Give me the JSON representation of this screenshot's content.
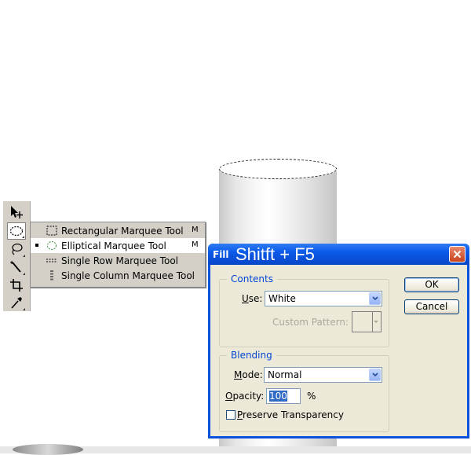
{
  "toolbox": {
    "tools": [
      {
        "name": "move-tool",
        "icon": "move-arrow-icon",
        "selected": false
      },
      {
        "name": "elliptical-marquee-tool",
        "icon": "ellipse-marquee-icon",
        "selected": true
      },
      {
        "name": "lasso-tool",
        "icon": "lasso-icon",
        "selected": false
      },
      {
        "name": "magic-wand-tool",
        "icon": "magic-wand-icon",
        "selected": false
      },
      {
        "name": "crop-tool",
        "icon": "crop-icon",
        "selected": false
      },
      {
        "name": "eyedropper-tool",
        "icon": "eyedropper-icon",
        "selected": false
      }
    ]
  },
  "flyout": {
    "items": [
      {
        "label": "Rectangular Marquee Tool",
        "shortcut": "M",
        "icon": "rect-marquee-icon",
        "active": false
      },
      {
        "label": "Elliptical Marquee Tool",
        "shortcut": "M",
        "icon": "ellipse-marquee-icon",
        "active": true
      },
      {
        "label": "Single Row Marquee Tool",
        "shortcut": "",
        "icon": "single-row-marquee-icon",
        "active": false
      },
      {
        "label": "Single Column Marquee Tool",
        "shortcut": "",
        "icon": "single-column-marquee-icon",
        "active": false
      }
    ]
  },
  "dialog": {
    "title": "Fill",
    "title_annotation": "Shitft + F5",
    "contents": {
      "legend": "Contents",
      "use_label_u": "U",
      "use_label_rest": "se:",
      "use_value": "White",
      "custom_pattern_label": "Custom Pattern:"
    },
    "blending": {
      "legend": "Blending",
      "mode_label_u": "M",
      "mode_label_rest": "ode:",
      "mode_value": "Normal",
      "opacity_label_u": "O",
      "opacity_label_rest": "pacity:",
      "opacity_value": "100",
      "opacity_unit": "%",
      "preserve_u": "P",
      "preserve_rest": "reserve Transparency",
      "preserve_checked": false
    },
    "ok_label": "OK",
    "cancel_label": "Cancel"
  },
  "colors": {
    "titlebar": "#0a52dc",
    "dialog_bg": "#ece9d8",
    "legend_text": "#0046d5",
    "selection_highlight": "#316ac5"
  }
}
